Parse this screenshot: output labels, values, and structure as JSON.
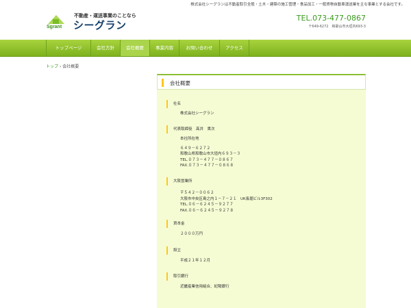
{
  "header": {
    "tagline": "株式会社シーグランは不動産取引全般・土木・建築の施工管理・食品加工・一般貨物自動車運送業を主な事業とする会社です。",
    "logo_small": "不動産・運送事業のことなら",
    "logo_big": "シーグラン",
    "logo_mark_text": "Sgrant",
    "tel": "TEL.073-477-0867",
    "address": "〒649-6272　和歌山市大垣内693-3"
  },
  "nav": {
    "items": [
      {
        "label": "トップページ"
      },
      {
        "label": "会社方針"
      },
      {
        "label": "会社概要"
      },
      {
        "label": "事業内容"
      },
      {
        "label": "お問い合わせ"
      },
      {
        "label": "アクセス"
      }
    ],
    "active_index": 2
  },
  "breadcrumb": {
    "home": "トップ",
    "separator": "›",
    "current": "会社概要"
  },
  "content": {
    "title": "会社概要",
    "sections": [
      {
        "label": "社名",
        "lines": [
          "株式会社シーグラン"
        ]
      },
      {
        "label": " 代表取締役　髙井　貴次",
        "lines": [
          "本社所在地",
          "",
          "６４９－６２７２",
          "和歌山県和歌山市大垣内６９３－３",
          "TEL.０７３－４７７－０８６７",
          "FAX.０７３－４７７－０８６８"
        ]
      },
      {
        "label": "大阪営業所",
        "lines": [
          "〒５４２－００６２",
          "大阪市中央区島之内１－７－２１　UK長堀ビル3F302",
          "TEL.０６－６２４５－９２７７",
          "FAX.０６－６２４５－９２７８"
        ]
      },
      {
        "label": "資本金",
        "lines": [
          "２０００万円"
        ]
      },
      {
        "label": "設立",
        "lines": [
          "平成２１年１２月"
        ]
      },
      {
        "label": "取引銀行",
        "lines": [
          "近畿産業信用組合、紀陽銀行"
        ]
      }
    ]
  },
  "colors": {
    "nav_green": "#8cc12b",
    "accent_yellow": "#ffc61a",
    "tel_green": "#3a9a1e",
    "content_bg": "#f5fbd3",
    "logo_blue": "#17406b"
  }
}
